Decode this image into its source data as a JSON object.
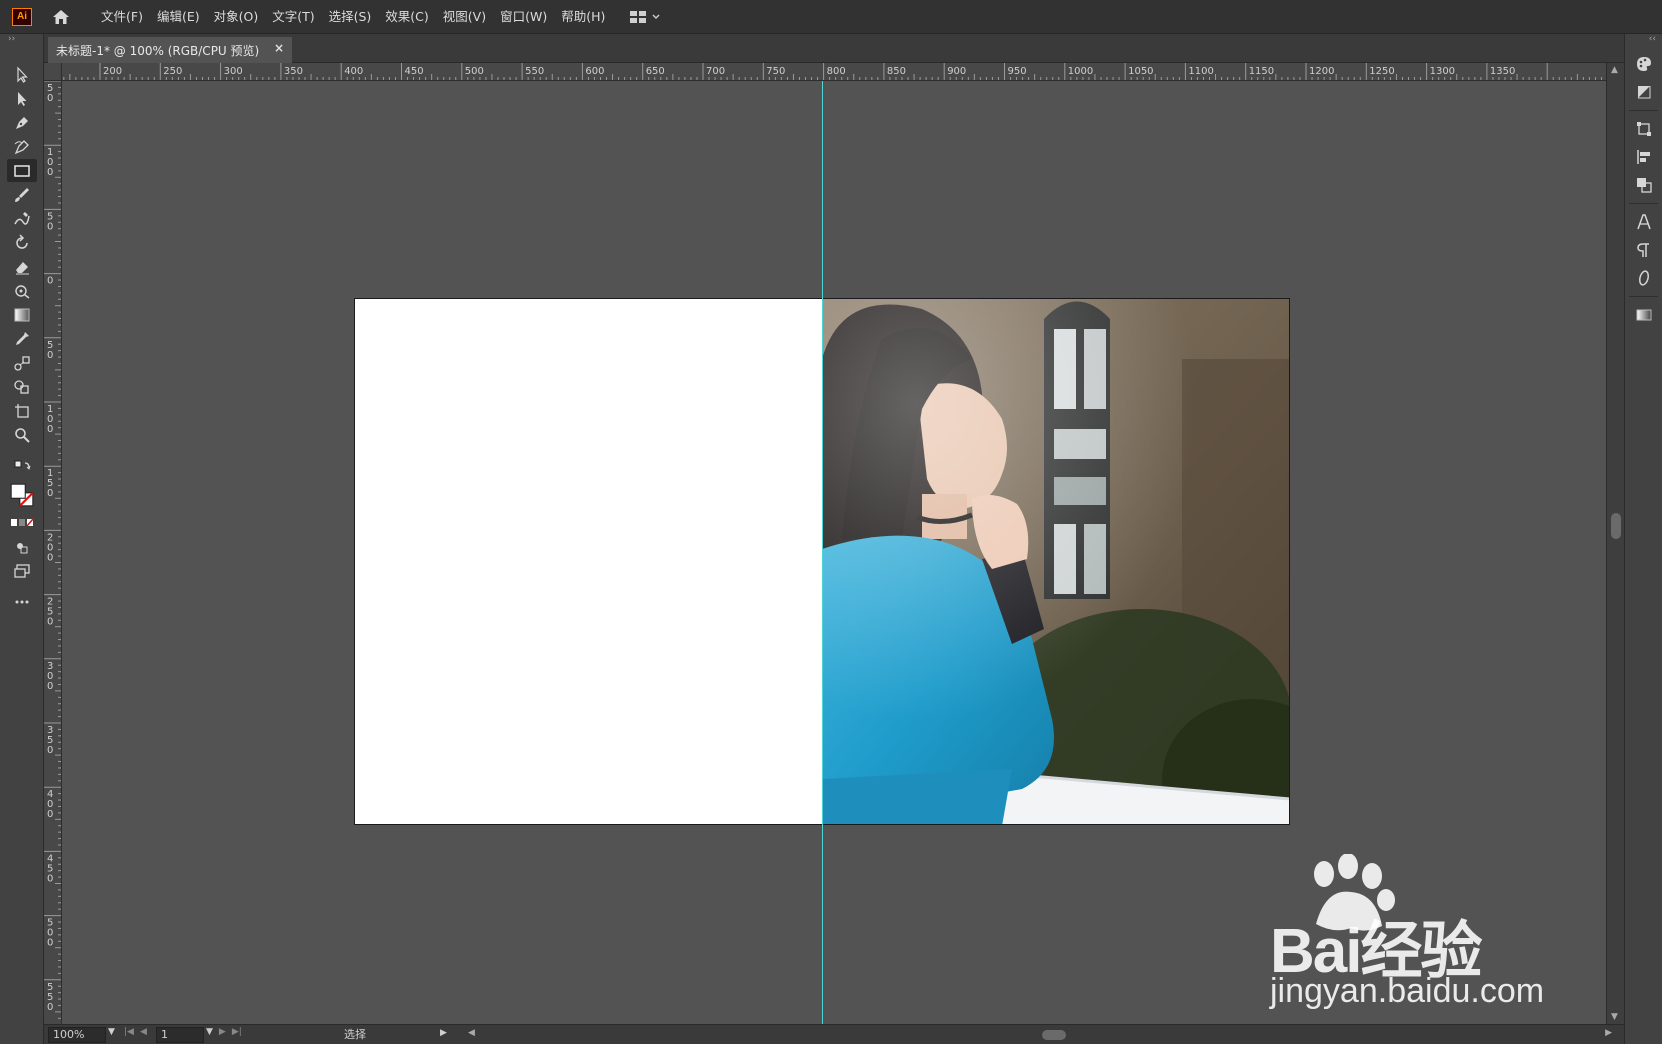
{
  "app": {
    "logo_text": "Ai"
  },
  "menu": [
    "文件(F)",
    "编辑(E)",
    "对象(O)",
    "文字(T)",
    "选择(S)",
    "效果(C)",
    "视图(V)",
    "窗口(W)",
    "帮助(H)"
  ],
  "document": {
    "tab_title": "未标题-1* @ 100% (RGB/CPU 预览)",
    "close_glyph": "×"
  },
  "ruler": {
    "horizontal_labels": [
      "200",
      "250",
      "300",
      "350",
      "400",
      "450",
      "500",
      "550",
      "600",
      "650",
      "700",
      "750",
      "800",
      "850",
      "900",
      "950",
      "1000",
      "1050",
      "1100",
      "1150",
      "1200",
      "1250",
      "1300",
      "1350"
    ],
    "vertical_labels": [
      "50",
      "100",
      "50",
      "0",
      "50",
      "100",
      "150",
      "200",
      "250",
      "300",
      "350",
      "400",
      "450",
      "500",
      "550"
    ]
  },
  "tools": [
    "selection-tool",
    "direct-selection-tool",
    "pen-tool",
    "curvature-tool",
    "rectangle-tool",
    "paintbrush-tool",
    "shaper-tool",
    "rotate-tool",
    "eraser-tool",
    "puppet-warp-tool",
    "gradient-tool",
    "eyedropper-tool",
    "blend-tool",
    "shape-builder-tool",
    "artboard-tool",
    "zoom-tool"
  ],
  "status": {
    "zoom": "100%",
    "artboard": "1",
    "mode": "选择"
  },
  "watermark": {
    "brand": "Bai经验",
    "url": "jingyan.baidu.com"
  },
  "colors": {
    "guide": "#4fd3d3",
    "canvas": "#535353",
    "artboard": "#ffffff"
  }
}
